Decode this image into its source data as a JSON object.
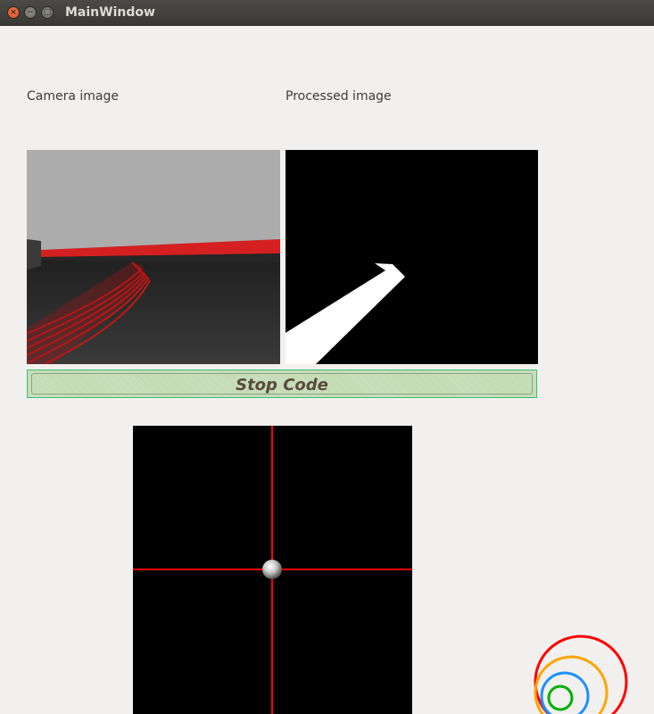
{
  "window": {
    "title": "MainWindow",
    "controls": {
      "close_glyph": "×",
      "minimize_glyph": "−",
      "maximize_glyph": "□"
    }
  },
  "labels": {
    "camera": "Camera image",
    "processed": "Processed image"
  },
  "controls": {
    "stop_label": "Stop Code"
  },
  "colors": {
    "stop_button_fill": "#c6ddb8",
    "stop_button_border": "#3bbf7a",
    "crosshair": "#ff0000",
    "ring_outer": "#ff0000",
    "ring_second": "#ffa500",
    "ring_third": "#1e90ff",
    "ring_inner": "#00b000"
  }
}
